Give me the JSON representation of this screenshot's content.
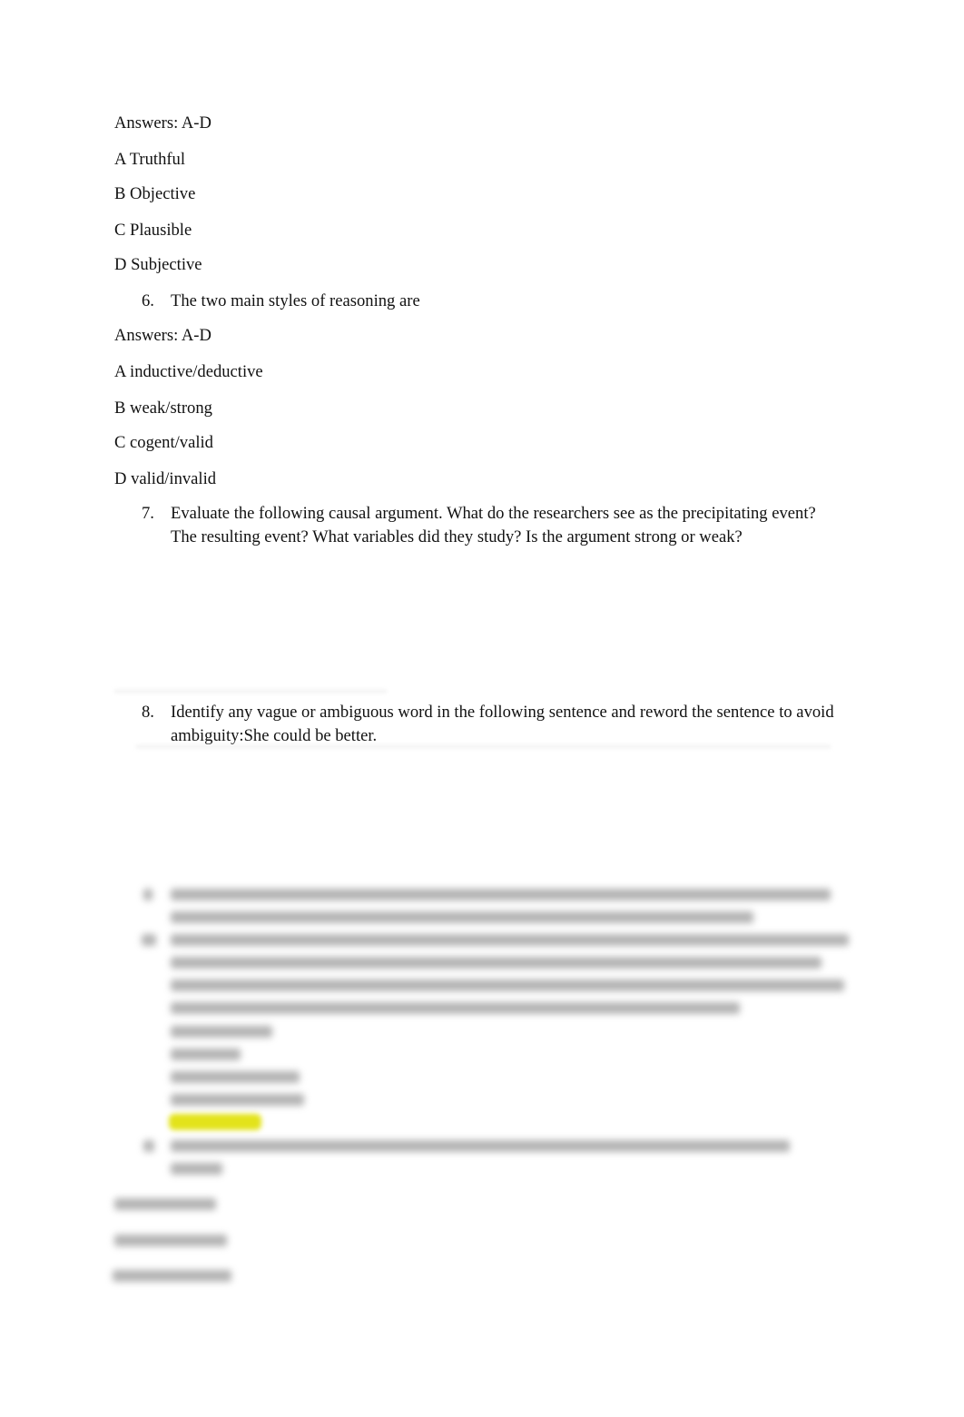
{
  "q5": {
    "answers_label": "Answers: A-D",
    "options": [
      "A Truthful",
      "B Objective",
      "C Plausible",
      "D Subjective"
    ]
  },
  "q6": {
    "number": "6.",
    "text": "The two main styles of reasoning are",
    "answers_label": "Answers: A-D",
    "options": [
      "A inductive/deductive",
      "B weak/strong",
      "C cogent/valid",
      "D valid/invalid"
    ]
  },
  "q7": {
    "number": "7.",
    "text": "Evaluate the following causal argument. What do the researchers see as the precipitating event? The resulting event? What variables did they study? Is the argument strong or weak?"
  },
  "q8": {
    "number": "8.",
    "text": "Identify any vague or ambiguous word in the following sentence and reword the sentence to avoid ambiguity:She could be better."
  },
  "colors": {
    "highlight": "#e3e31a",
    "blurred_text": "#9a9a9a"
  }
}
